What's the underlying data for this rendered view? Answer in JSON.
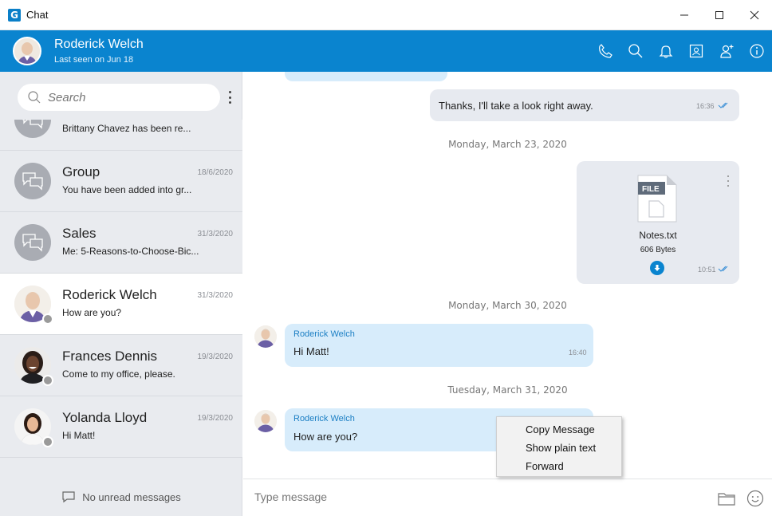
{
  "window": {
    "title": "Chat",
    "logo_letter": "G",
    "minimize": "–",
    "maximize": "☐",
    "close": "✕"
  },
  "header": {
    "name": "Roderick Welch",
    "status": "Last seen on Jun 18",
    "accent_color": "#0a84cf",
    "icons": [
      "phone-icon",
      "search-icon",
      "bell-icon",
      "contact-card-icon",
      "add-user-icon",
      "info-icon"
    ]
  },
  "sidebar": {
    "search_placeholder": "Search",
    "conversations": [
      {
        "name": "",
        "date": "",
        "preview": "Brittany Chavez has been re...",
        "type": "group"
      },
      {
        "name": "Group",
        "date": "18/6/2020",
        "preview": "You have been added into gr...",
        "type": "group"
      },
      {
        "name": "Sales",
        "date": "31/3/2020",
        "preview": "Me: 5-Reasons-to-Choose-Bic...",
        "type": "group"
      },
      {
        "name": "Roderick Welch",
        "date": "31/3/2020",
        "preview": "How are you?",
        "type": "person",
        "active": true
      },
      {
        "name": "Frances Dennis",
        "date": "19/3/2020",
        "preview": "Come to my office, please.",
        "type": "person"
      },
      {
        "name": "Yolanda Lloyd",
        "date": "19/3/2020",
        "preview": "Hi Matt!",
        "type": "person"
      }
    ],
    "no_unread": "No unread messages"
  },
  "chat": {
    "messages": [
      {
        "text": "Thanks, I'll take a look right away.",
        "time": "16:36",
        "direction": "out"
      },
      {
        "date": "Monday, March 23, 2020"
      },
      {
        "file": {
          "badge": "FILE",
          "name": "Notes.txt",
          "size": "606 Bytes"
        },
        "time": "10:51",
        "direction": "out"
      },
      {
        "date": "Monday, March 30, 2020"
      },
      {
        "sender": "Roderick Welch",
        "text": "Hi Matt!",
        "time": "16:40",
        "direction": "in"
      },
      {
        "date": "Tuesday, March 31, 2020"
      },
      {
        "sender": "Roderick Welch",
        "text": "How are you?",
        "direction": "in"
      }
    ]
  },
  "context_menu": {
    "items": [
      "Copy Message",
      "Show plain text",
      "Forward"
    ]
  },
  "input": {
    "placeholder": "Type message"
  }
}
